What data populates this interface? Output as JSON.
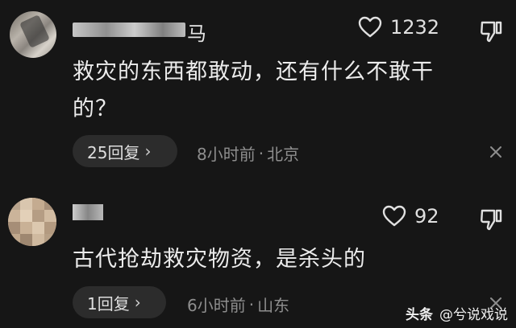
{
  "comments": [
    {
      "username_suffix": "马",
      "text_line1": "救灾的东西都敢动，还有什么不敢干",
      "text_line2": "的？",
      "likes": "1232",
      "reply_label": "25回复",
      "time": "8小时前",
      "separator": "·",
      "location": "北京"
    },
    {
      "text_line1": "古代抢劫救灾物资，是杀头的",
      "likes": "92",
      "reply_label": "1回复",
      "time": "6小时前",
      "separator": "·",
      "location": "山东"
    }
  ],
  "watermark": {
    "brand": "头条",
    "handle": "@兮说戏说"
  },
  "colors": {
    "background": "#161616",
    "pill": "#2c2c2c",
    "meta": "#8e8e8e"
  },
  "icons": {
    "like": "heart-icon",
    "dislike": "thumbs-down-icon",
    "dismiss": "close-icon",
    "expand": "chevron-right-icon"
  }
}
